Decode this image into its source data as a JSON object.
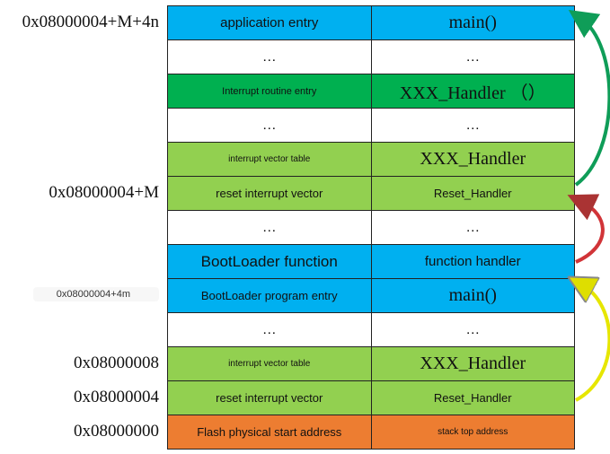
{
  "addresses": {
    "app_entry": "0x08000004+M+4n",
    "app_reset": "0x08000004+M",
    "boot_entry": "0x08000004+4m",
    "vector_table": "0x08000008",
    "reset_vector": "0x08000004",
    "flash_start": "0x08000000"
  },
  "rows": [
    {
      "left": "application entry",
      "right": "main()"
    },
    {
      "left": "…",
      "right": "…"
    },
    {
      "left": "Interrupt routine entry",
      "right": "XXX_Handler （）"
    },
    {
      "left": "…",
      "right": "…"
    },
    {
      "left": "interrupt vector table",
      "right": "XXX_Handler"
    },
    {
      "left": "reset interrupt vector",
      "right": "Reset_Handler"
    },
    {
      "left": "…",
      "right": "…"
    },
    {
      "left": "BootLoader function",
      "right": "function handler"
    },
    {
      "left": "BootLoader program entry",
      "right": "main()"
    },
    {
      "left": "…",
      "right": "…"
    },
    {
      "left": "interrupt vector table",
      "right": "XXX_Handler"
    },
    {
      "left": "reset interrupt vector",
      "right": "Reset_Handler"
    },
    {
      "left": "Flash physical start address",
      "right": "stack top address"
    }
  ],
  "colors": {
    "blue": "#00b0f0",
    "dark_green": "#00b050",
    "light_green": "#92d050",
    "orange": "#ed7d31",
    "arrow_green": "#0f9d58",
    "arrow_red": "#d13438",
    "arrow_yellow": "#e6e600"
  }
}
